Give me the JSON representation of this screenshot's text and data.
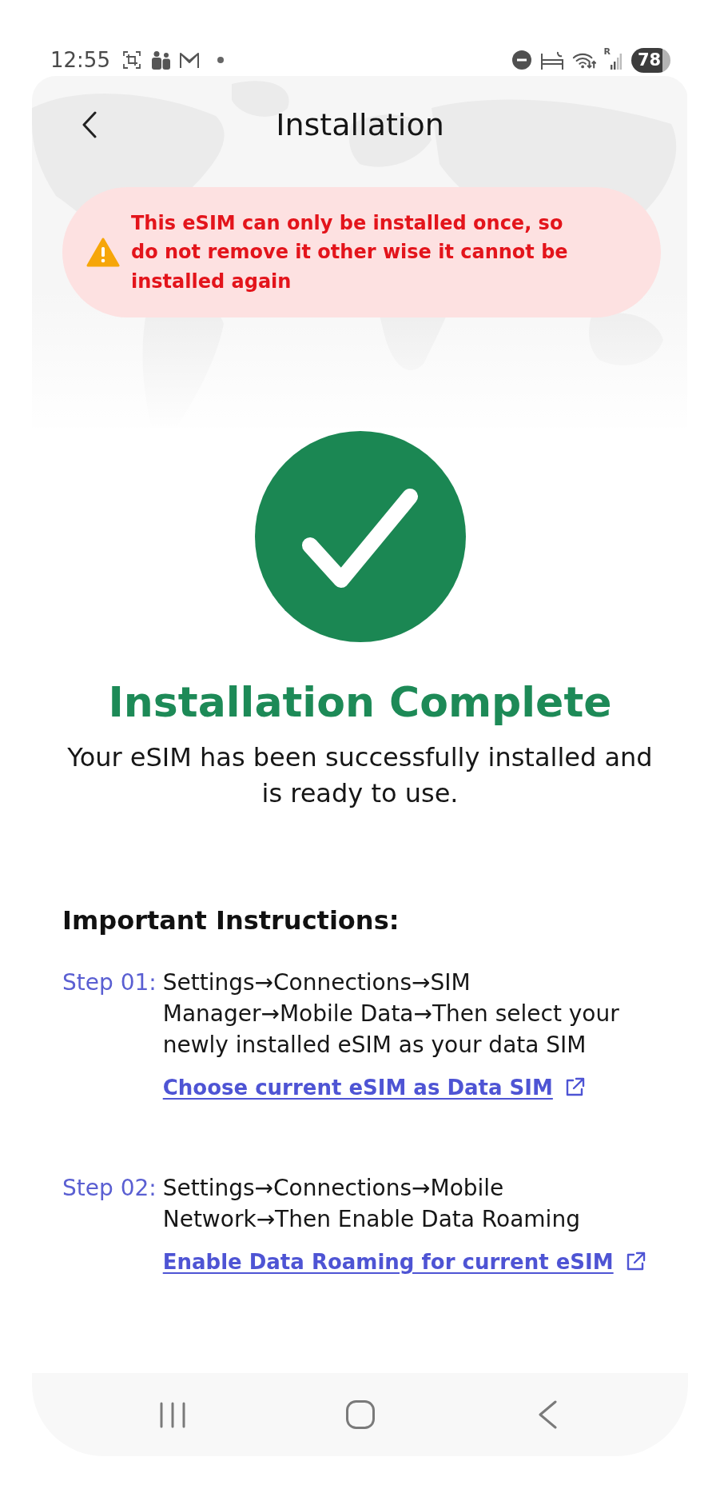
{
  "status_bar": {
    "time": "12:55",
    "roaming_mark": "R",
    "battery": "78"
  },
  "header": {
    "title": "Installation"
  },
  "warning": {
    "text": "This eSIM can only be installed once, so do not remove it other wise it cannot be installed again"
  },
  "result": {
    "title": "Installation Complete",
    "message": "Your eSIM has been successfully installed and is ready to use."
  },
  "instructions": {
    "heading": "Important Instructions:",
    "steps": [
      {
        "label": "Step 01:",
        "text": "Settings→Connections→SIM Manager→Mobile Data→Then select your newly installed eSIM as your data SIM",
        "link": "Choose current eSIM as Data SIM"
      },
      {
        "label": "Step 02:",
        "text": "Settings→Connections→Mobile Network→Then Enable Data Roaming",
        "link": "Enable Data Roaming for current eSIM"
      }
    ]
  }
}
